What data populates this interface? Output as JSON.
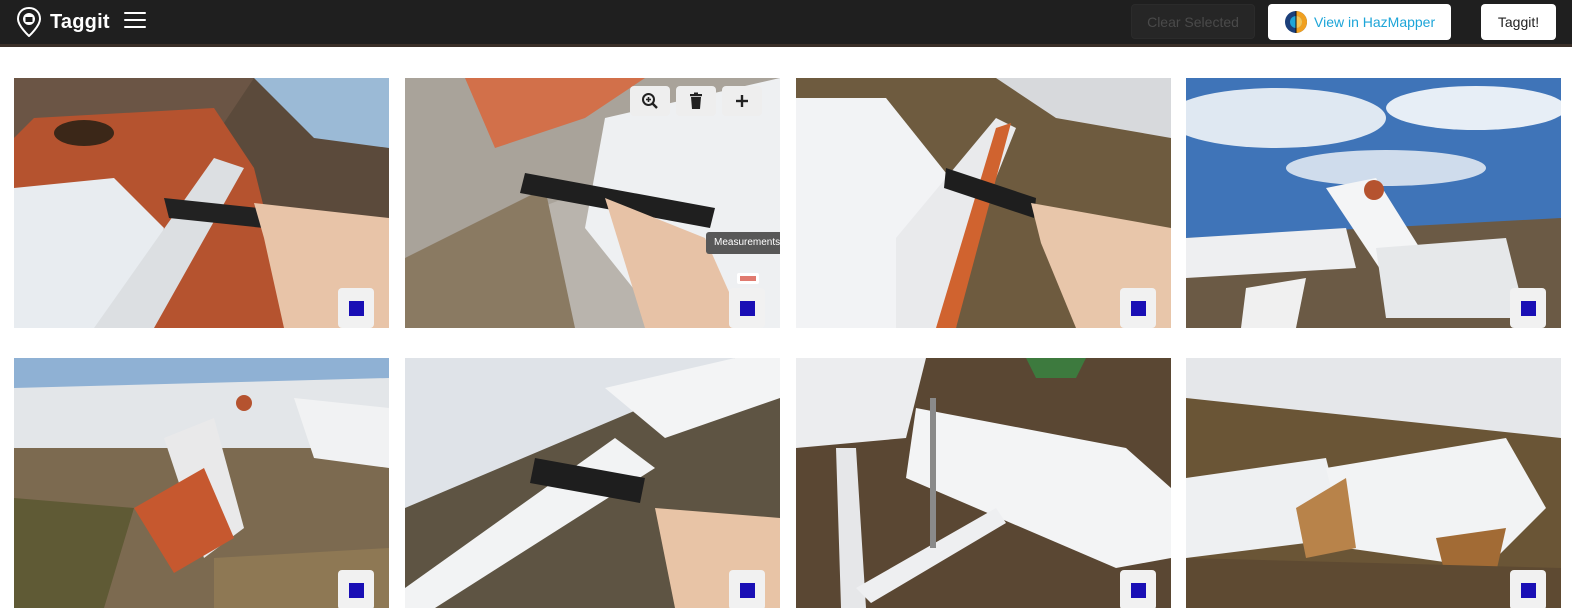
{
  "app": {
    "name": "Taggit",
    "logo_icon": "map-pin-logo-icon",
    "menu_icon": "hamburger-menu-icon"
  },
  "toolbar": {
    "clear_selected_label": "Clear Selected",
    "hazmapper_label": "View in HazMapper",
    "hazmapper_icon": "hazmapper-globe-icon",
    "taggit_label": "Taggit!"
  },
  "colors": {
    "topbar": "#1f1f1f",
    "accent_link": "#1da5d8",
    "select_square": "#1a0fb5",
    "tag_chip": "#e07a6f"
  },
  "gallery": {
    "photos": [
      {
        "subject": "caliper on orange pole flange",
        "selected": false
      },
      {
        "subject": "caliper on concrete and rust",
        "selected": false,
        "hovered": true
      },
      {
        "subject": "caliper on white pole flange",
        "selected": false
      },
      {
        "subject": "collapsed white poles under blue sky",
        "selected": false
      },
      {
        "subject": "fallen orange-capped pole in debris",
        "selected": false
      },
      {
        "subject": "caliper measuring white bar",
        "selected": false
      },
      {
        "subject": "white pipe in debris",
        "selected": false
      },
      {
        "subject": "torn white pole with rust",
        "selected": false
      }
    ],
    "hover_tools": {
      "zoom_icon": "zoom-in-icon",
      "delete_icon": "trash-icon",
      "add_icon": "plus-icon"
    },
    "tooltip_text": "Measurements"
  }
}
